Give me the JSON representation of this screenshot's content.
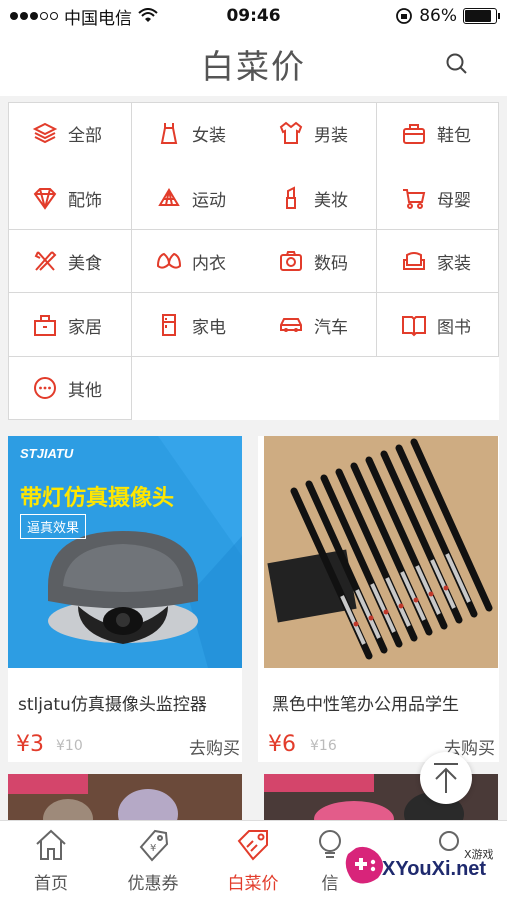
{
  "status_bar": {
    "carrier": "中国电信",
    "time": "09:46",
    "battery": "86%",
    "battery_level": 0.86
  },
  "header": {
    "title": "白菜价",
    "search_icon": "search-icon"
  },
  "categories": [
    {
      "label": "全部",
      "icon": "layers-icon"
    },
    {
      "label": "女装",
      "icon": "dress-icon"
    },
    {
      "label": "男装",
      "icon": "shirt-icon"
    },
    {
      "label": "鞋包",
      "icon": "bag-icon"
    },
    {
      "label": "配饰",
      "icon": "diamond-icon"
    },
    {
      "label": "运动",
      "icon": "sport-icon"
    },
    {
      "label": "美妆",
      "icon": "lipstick-icon"
    },
    {
      "label": "母婴",
      "icon": "stroller-icon"
    },
    {
      "label": "美食",
      "icon": "fork-knife-icon"
    },
    {
      "label": "内衣",
      "icon": "bra-icon"
    },
    {
      "label": "数码",
      "icon": "camera-icon"
    },
    {
      "label": "家装",
      "icon": "sofa-icon"
    },
    {
      "label": "家居",
      "icon": "home-bag-icon"
    },
    {
      "label": "家电",
      "icon": "fridge-icon"
    },
    {
      "label": "汽车",
      "icon": "car-icon"
    },
    {
      "label": "图书",
      "icon": "book-icon"
    },
    {
      "label": "其他",
      "icon": "more-icon"
    }
  ],
  "products": [
    {
      "name": "stljatu仿真摄像头监控器",
      "price": "¥3",
      "original_price": "¥10",
      "buy_label": "去购买",
      "image": {
        "brand": "STJIATU",
        "headline": "带灯仿真摄像头",
        "tag": "逼真效果"
      }
    },
    {
      "name": "黑色中性笔办公用品学生",
      "price": "¥6",
      "original_price": "¥16",
      "buy_label": "去购买"
    }
  ],
  "tabs": [
    {
      "label": "首页",
      "icon": "home-icon",
      "active": false
    },
    {
      "label": "优惠券",
      "icon": "coupon-icon",
      "active": false
    },
    {
      "label": "白菜价",
      "icon": "price-tag-icon",
      "active": true
    },
    {
      "label": "信",
      "icon": "bulb-icon",
      "active": false
    }
  ],
  "watermark": {
    "text": "XYouXi.net",
    "small": "X游戏"
  },
  "colors": {
    "accent": "#e23c2b",
    "camera_bg": "#2d9de3",
    "pen_bg": "#c9a67c"
  }
}
